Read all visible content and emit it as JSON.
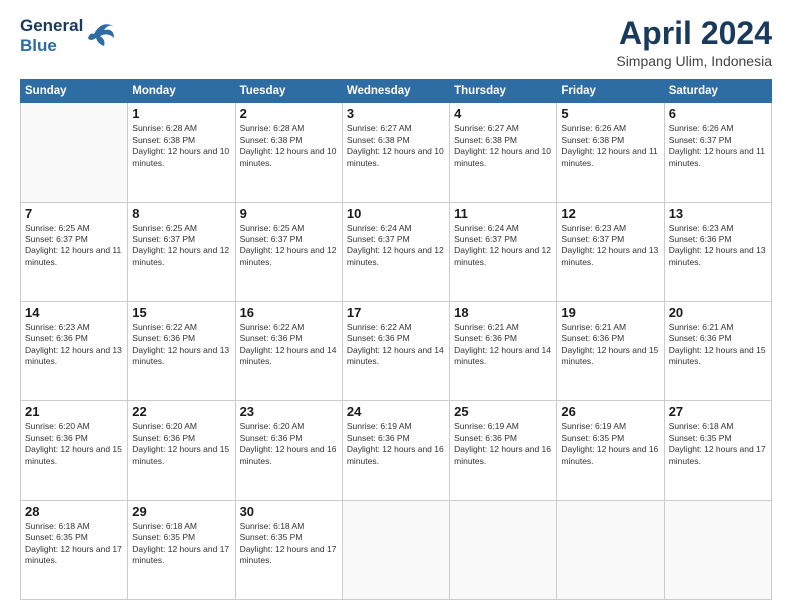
{
  "header": {
    "logo_line1": "General",
    "logo_line2": "Blue",
    "month": "April 2024",
    "location": "Simpang Ulim, Indonesia"
  },
  "days_of_week": [
    "Sunday",
    "Monday",
    "Tuesday",
    "Wednesday",
    "Thursday",
    "Friday",
    "Saturday"
  ],
  "weeks": [
    [
      {
        "day": "",
        "sunrise": "",
        "sunset": "",
        "daylight": ""
      },
      {
        "day": "1",
        "sunrise": "Sunrise: 6:28 AM",
        "sunset": "Sunset: 6:38 PM",
        "daylight": "Daylight: 12 hours and 10 minutes."
      },
      {
        "day": "2",
        "sunrise": "Sunrise: 6:28 AM",
        "sunset": "Sunset: 6:38 PM",
        "daylight": "Daylight: 12 hours and 10 minutes."
      },
      {
        "day": "3",
        "sunrise": "Sunrise: 6:27 AM",
        "sunset": "Sunset: 6:38 PM",
        "daylight": "Daylight: 12 hours and 10 minutes."
      },
      {
        "day": "4",
        "sunrise": "Sunrise: 6:27 AM",
        "sunset": "Sunset: 6:38 PM",
        "daylight": "Daylight: 12 hours and 10 minutes."
      },
      {
        "day": "5",
        "sunrise": "Sunrise: 6:26 AM",
        "sunset": "Sunset: 6:38 PM",
        "daylight": "Daylight: 12 hours and 11 minutes."
      },
      {
        "day": "6",
        "sunrise": "Sunrise: 6:26 AM",
        "sunset": "Sunset: 6:37 PM",
        "daylight": "Daylight: 12 hours and 11 minutes."
      }
    ],
    [
      {
        "day": "7",
        "sunrise": "Sunrise: 6:25 AM",
        "sunset": "Sunset: 6:37 PM",
        "daylight": "Daylight: 12 hours and 11 minutes."
      },
      {
        "day": "8",
        "sunrise": "Sunrise: 6:25 AM",
        "sunset": "Sunset: 6:37 PM",
        "daylight": "Daylight: 12 hours and 12 minutes."
      },
      {
        "day": "9",
        "sunrise": "Sunrise: 6:25 AM",
        "sunset": "Sunset: 6:37 PM",
        "daylight": "Daylight: 12 hours and 12 minutes."
      },
      {
        "day": "10",
        "sunrise": "Sunrise: 6:24 AM",
        "sunset": "Sunset: 6:37 PM",
        "daylight": "Daylight: 12 hours and 12 minutes."
      },
      {
        "day": "11",
        "sunrise": "Sunrise: 6:24 AM",
        "sunset": "Sunset: 6:37 PM",
        "daylight": "Daylight: 12 hours and 12 minutes."
      },
      {
        "day": "12",
        "sunrise": "Sunrise: 6:23 AM",
        "sunset": "Sunset: 6:37 PM",
        "daylight": "Daylight: 12 hours and 13 minutes."
      },
      {
        "day": "13",
        "sunrise": "Sunrise: 6:23 AM",
        "sunset": "Sunset: 6:36 PM",
        "daylight": "Daylight: 12 hours and 13 minutes."
      }
    ],
    [
      {
        "day": "14",
        "sunrise": "Sunrise: 6:23 AM",
        "sunset": "Sunset: 6:36 PM",
        "daylight": "Daylight: 12 hours and 13 minutes."
      },
      {
        "day": "15",
        "sunrise": "Sunrise: 6:22 AM",
        "sunset": "Sunset: 6:36 PM",
        "daylight": "Daylight: 12 hours and 13 minutes."
      },
      {
        "day": "16",
        "sunrise": "Sunrise: 6:22 AM",
        "sunset": "Sunset: 6:36 PM",
        "daylight": "Daylight: 12 hours and 14 minutes."
      },
      {
        "day": "17",
        "sunrise": "Sunrise: 6:22 AM",
        "sunset": "Sunset: 6:36 PM",
        "daylight": "Daylight: 12 hours and 14 minutes."
      },
      {
        "day": "18",
        "sunrise": "Sunrise: 6:21 AM",
        "sunset": "Sunset: 6:36 PM",
        "daylight": "Daylight: 12 hours and 14 minutes."
      },
      {
        "day": "19",
        "sunrise": "Sunrise: 6:21 AM",
        "sunset": "Sunset: 6:36 PM",
        "daylight": "Daylight: 12 hours and 15 minutes."
      },
      {
        "day": "20",
        "sunrise": "Sunrise: 6:21 AM",
        "sunset": "Sunset: 6:36 PM",
        "daylight": "Daylight: 12 hours and 15 minutes."
      }
    ],
    [
      {
        "day": "21",
        "sunrise": "Sunrise: 6:20 AM",
        "sunset": "Sunset: 6:36 PM",
        "daylight": "Daylight: 12 hours and 15 minutes."
      },
      {
        "day": "22",
        "sunrise": "Sunrise: 6:20 AM",
        "sunset": "Sunset: 6:36 PM",
        "daylight": "Daylight: 12 hours and 15 minutes."
      },
      {
        "day": "23",
        "sunrise": "Sunrise: 6:20 AM",
        "sunset": "Sunset: 6:36 PM",
        "daylight": "Daylight: 12 hours and 16 minutes."
      },
      {
        "day": "24",
        "sunrise": "Sunrise: 6:19 AM",
        "sunset": "Sunset: 6:36 PM",
        "daylight": "Daylight: 12 hours and 16 minutes."
      },
      {
        "day": "25",
        "sunrise": "Sunrise: 6:19 AM",
        "sunset": "Sunset: 6:36 PM",
        "daylight": "Daylight: 12 hours and 16 minutes."
      },
      {
        "day": "26",
        "sunrise": "Sunrise: 6:19 AM",
        "sunset": "Sunset: 6:35 PM",
        "daylight": "Daylight: 12 hours and 16 minutes."
      },
      {
        "day": "27",
        "sunrise": "Sunrise: 6:18 AM",
        "sunset": "Sunset: 6:35 PM",
        "daylight": "Daylight: 12 hours and 17 minutes."
      }
    ],
    [
      {
        "day": "28",
        "sunrise": "Sunrise: 6:18 AM",
        "sunset": "Sunset: 6:35 PM",
        "daylight": "Daylight: 12 hours and 17 minutes."
      },
      {
        "day": "29",
        "sunrise": "Sunrise: 6:18 AM",
        "sunset": "Sunset: 6:35 PM",
        "daylight": "Daylight: 12 hours and 17 minutes."
      },
      {
        "day": "30",
        "sunrise": "Sunrise: 6:18 AM",
        "sunset": "Sunset: 6:35 PM",
        "daylight": "Daylight: 12 hours and 17 minutes."
      },
      {
        "day": "",
        "sunrise": "",
        "sunset": "",
        "daylight": ""
      },
      {
        "day": "",
        "sunrise": "",
        "sunset": "",
        "daylight": ""
      },
      {
        "day": "",
        "sunrise": "",
        "sunset": "",
        "daylight": ""
      },
      {
        "day": "",
        "sunrise": "",
        "sunset": "",
        "daylight": ""
      }
    ]
  ]
}
